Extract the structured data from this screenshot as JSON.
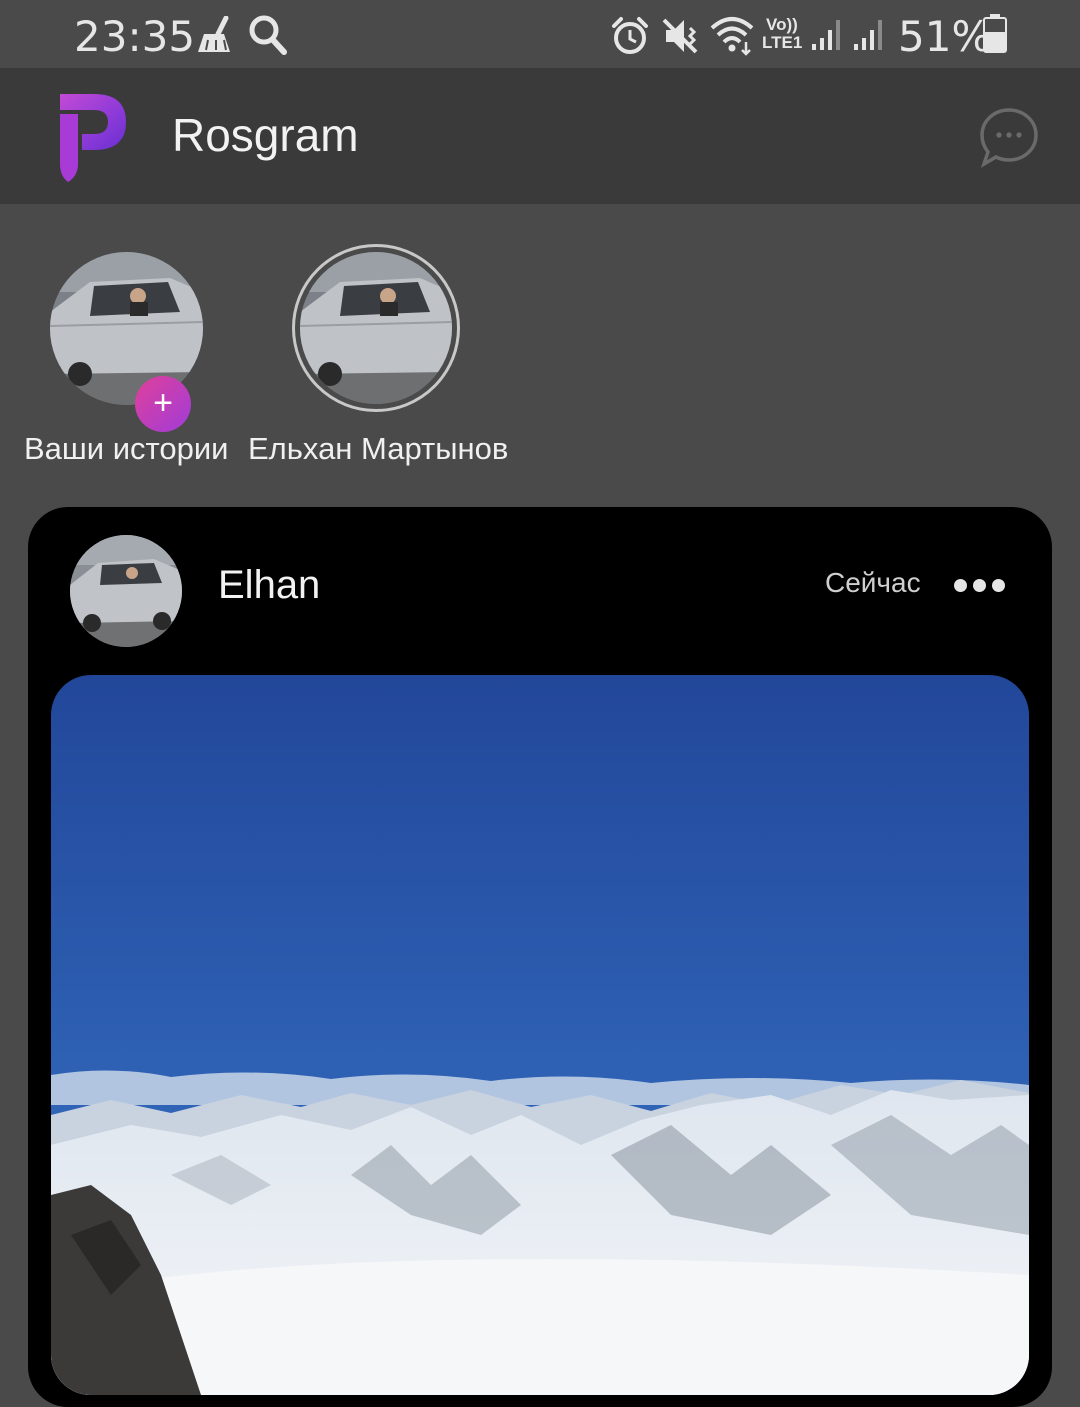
{
  "status_bar": {
    "time": "23:35",
    "battery_percent": "51%",
    "network_label_top": "Vo))",
    "network_label_bottom": "LTE1",
    "icons": [
      "cleaner-icon",
      "search-icon",
      "alarm-icon",
      "mute-icon",
      "wifi-icon",
      "signal-icon",
      "signal-icon",
      "battery-icon"
    ]
  },
  "header": {
    "title": "Rosgram",
    "logo_icon": "rosgram-logo",
    "chat_icon": "chat-bubble-icon"
  },
  "colors": {
    "background": "#4a4a4a",
    "header": "#3a3a3a",
    "card": "#000000",
    "accent_start": "#e0409a",
    "accent_end": "#a03cd8"
  },
  "stories": [
    {
      "label": "Ваши истории",
      "badge": "+"
    },
    {
      "label": "Ельхан Мартынов"
    }
  ],
  "post": {
    "author": "Elhan",
    "time": "Сейчас",
    "menu_icon": "more-dots-icon"
  }
}
